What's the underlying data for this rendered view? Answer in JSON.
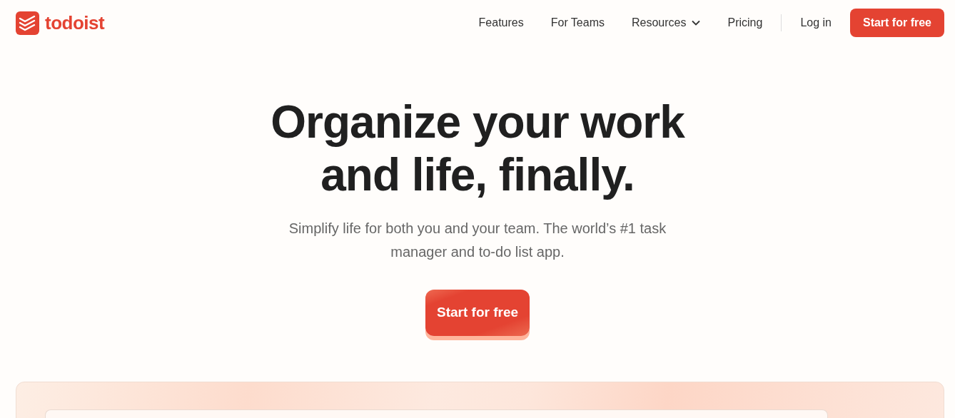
{
  "brand": {
    "name": "todoist"
  },
  "nav": [
    {
      "label": "Features",
      "kind": "link"
    },
    {
      "label": "For Teams",
      "kind": "link"
    },
    {
      "label": "Resources",
      "kind": "dropdown"
    },
    {
      "label": "Pricing",
      "kind": "link"
    }
  ],
  "login": "Log in",
  "header_cta": "Start for free",
  "hero": {
    "headline": [
      "Organize your work",
      "and life, finally."
    ],
    "subtitle": "Simplify life for both you and your team. The world’s #1 task manager and to-do list app.",
    "cta": "Start for free"
  }
}
